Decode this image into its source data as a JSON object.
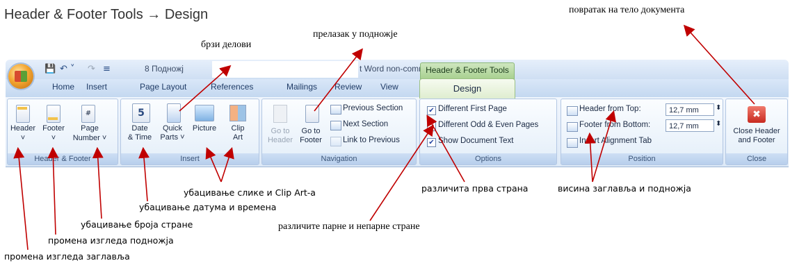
{
  "heading": "Header & Footer Tools → Design",
  "window": {
    "doc_title_left": "8 Подножј",
    "doc_title_right": "t Word non-commercial use",
    "contextual_tab_label": "Header & Footer Tools",
    "qat": {
      "save": "💾",
      "undo": "↶ ˅",
      "redo": "↷",
      "customize": "≡"
    }
  },
  "tabs": [
    "Home",
    "Insert",
    "Page Layout",
    "References",
    "Mailings",
    "Review",
    "View"
  ],
  "active_tab": "Design",
  "ribbon": {
    "header_footer_group": {
      "label": "Header & Footer",
      "header": "Header",
      "footer": "Footer",
      "page_number_1": "Page",
      "page_number_2": "Number ˅",
      "dropdown": "˅"
    },
    "insert_group": {
      "label": "Insert",
      "date_1": "Date",
      "date_2": "& Time",
      "quick_1": "Quick",
      "quick_2": "Parts ˅",
      "picture": "Picture",
      "clip_1": "Clip",
      "clip_2": "Art",
      "calendar_digit": "5"
    },
    "navigation_group": {
      "label": "Navigation",
      "goto_header_1": "Go to",
      "goto_header_2": "Header",
      "goto_footer_1": "Go to",
      "goto_footer_2": "Footer",
      "previous_section": "Previous Section",
      "next_section": "Next Section",
      "link_to_previous": "Link to Previous"
    },
    "options_group": {
      "label": "Options",
      "different_first_page": "Different First Page",
      "different_odd_even": "Different Odd & Even Pages",
      "show_document_text": "Show Document Text",
      "check": "✔"
    },
    "position_group": {
      "label": "Position",
      "header_from_top": "Header from Top:",
      "footer_from_bottom": "Footer from Bottom:",
      "insert_alignment_tab": "Insert Alignment Tab",
      "header_value": "12,7 mm",
      "footer_value": "12,7 mm",
      "spin": "⬍"
    },
    "close_group": {
      "label": "Close",
      "close_1": "Close Header",
      "close_2": "and Footer",
      "close_icon": "✖"
    }
  },
  "annotations": {
    "quick_parts": "брзи делови",
    "goto_footer": "прелазак у подножје",
    "return_body": "повратак на тело документа",
    "insert_picture_clipart": "убацивање слике и Clip Art-а",
    "insert_date_time": "убацивање датума и времена",
    "insert_page_number": "убацивање броја стране",
    "change_footer": "промена изгледа подножја",
    "change_header": "промена изгледа заглавља",
    "different_first_page": "различита прва страна",
    "header_footer_height": "висина заглавља и подножја",
    "odd_even_pages": "различите парне и непарне стране"
  },
  "colors": {
    "arrow": "#c00000",
    "ribbon_bg": "#dde9f7",
    "design_tab": "#dfedd0",
    "close_red": "#d9433a"
  }
}
